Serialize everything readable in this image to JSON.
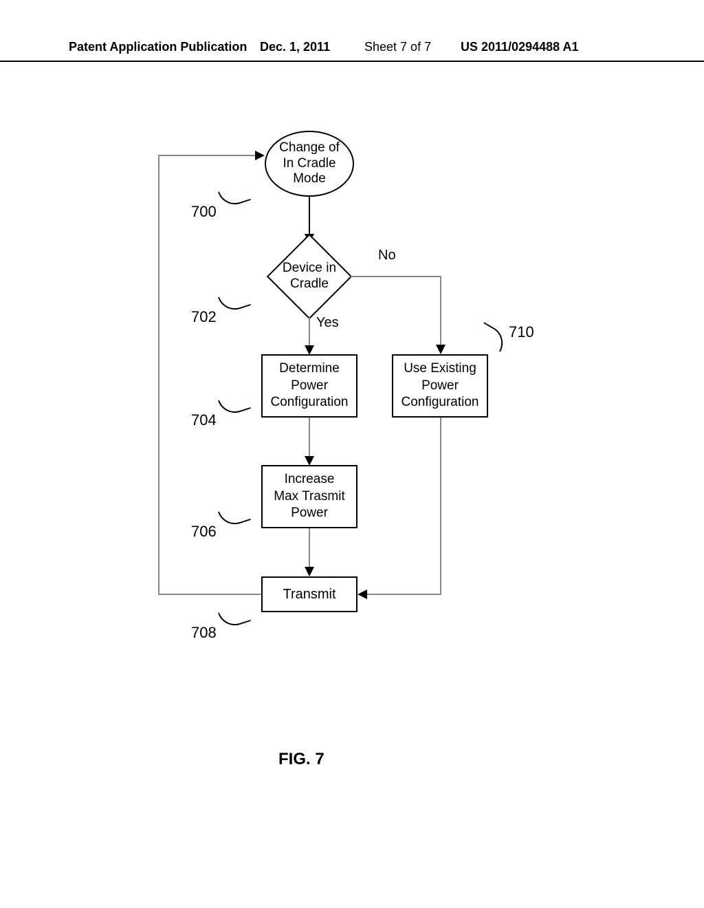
{
  "header": {
    "publication_type": "Patent Application Publication",
    "date": "Dec. 1, 2011",
    "sheet": "Sheet 7 of 7",
    "publication_number": "US 2011/0294488 A1"
  },
  "flowchart": {
    "start": {
      "line1": "Change of",
      "line2": "In Cradle",
      "line3": "Mode"
    },
    "decision": {
      "line1": "Device in",
      "line2": "Cradle"
    },
    "yes_label": "Yes",
    "no_label": "No",
    "determine": {
      "line1": "Determine",
      "line2": "Power",
      "line3": "Configuration"
    },
    "use_existing": {
      "line1": "Use Existing",
      "line2": "Power",
      "line3": "Configuration"
    },
    "increase": {
      "line1": "Increase",
      "line2": "Max Trasmit",
      "line3": "Power"
    },
    "transmit": {
      "label": "Transmit"
    }
  },
  "refs": {
    "r700": "700",
    "r702": "702",
    "r704": "704",
    "r706": "706",
    "r708": "708",
    "r710": "710"
  },
  "figure_caption": "FIG. 7"
}
